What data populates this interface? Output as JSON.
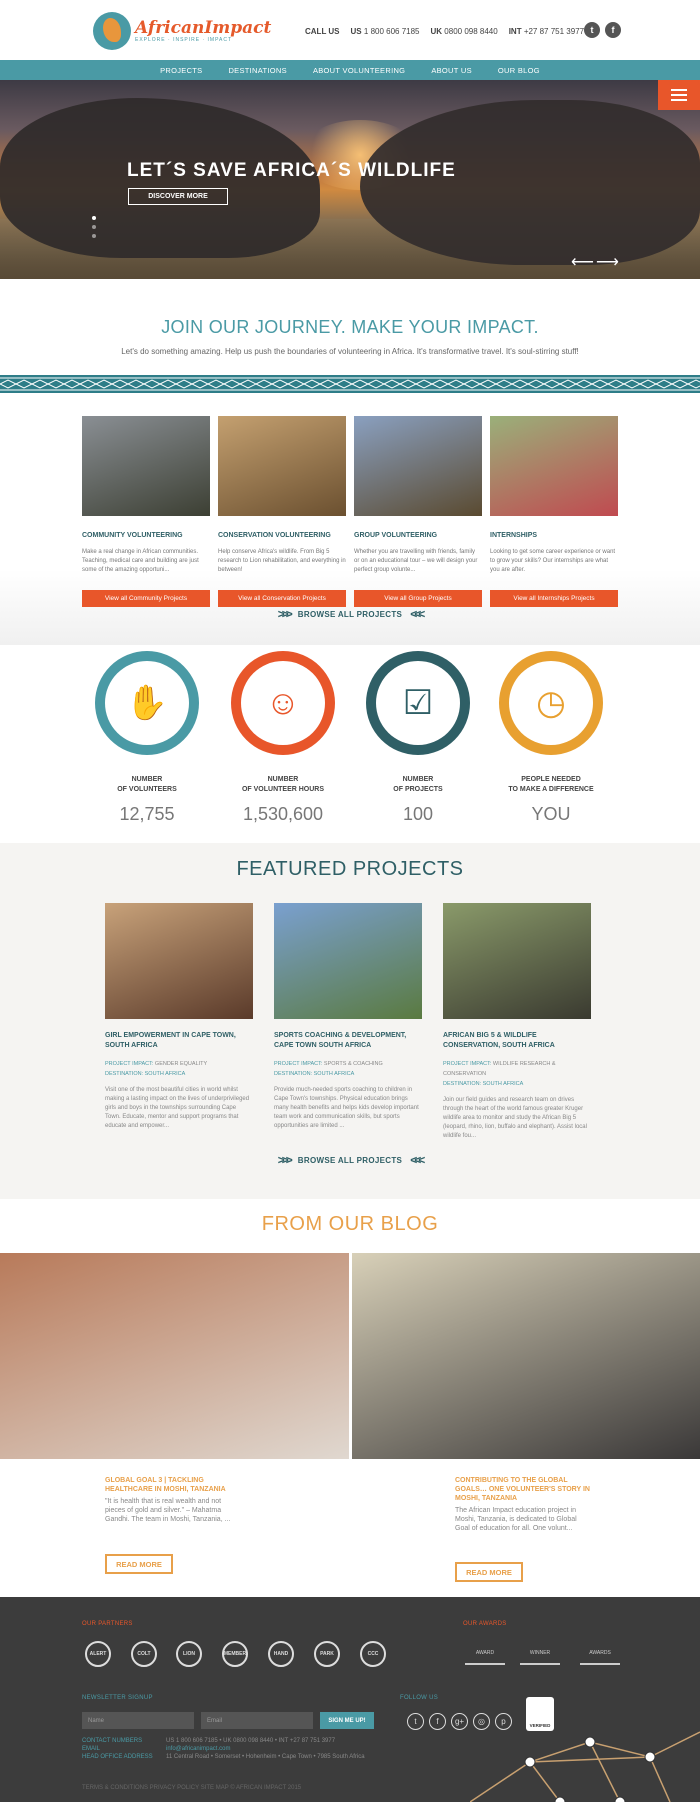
{
  "brand": {
    "name": "AfricanImpact",
    "tagline": "EXPLORE · INSPIRE · IMPACT"
  },
  "contact": {
    "call_label": "CALL US",
    "us_label": "US",
    "us_phone": "1 800 606 7185",
    "uk_label": "UK",
    "uk_phone": "0800 098 8440",
    "int_label": "INT",
    "int_phone": "+27 87 751 3977"
  },
  "social_top": [
    "t",
    "f"
  ],
  "nav": [
    "PROJECTS",
    "DESTINATIONS",
    "ABOUT VOLUNTEERING",
    "ABOUT US",
    "OUR BLOG"
  ],
  "hero": {
    "title": "LET´S SAVE AFRICA´S WILDLIFE",
    "cta": "DISCOVER MORE",
    "arrows": "⟵⟶"
  },
  "intro": {
    "title": "JOIN OUR JOURNEY. MAKE YOUR IMPACT.",
    "text": "Let's do something amazing. Help us push the boundaries of volunteering in Africa. It's transformative travel. It's soul-stirring stuff!"
  },
  "categories": [
    {
      "title": "COMMUNITY VOLUNTEERING",
      "text": "Make a real change in African communities. Teaching, medical care and building are just some of the amazing opportuni...",
      "button": "View all Community Projects",
      "c1": "#8a8f94",
      "c2": "#3c3f33"
    },
    {
      "title": "CONSERVATION VOLUNTEERING",
      "text": "Help conserve Africa's wildlife. From Big 5 research to Lion rehabilitation, and everything in between!",
      "button": "View all Conservation Projects",
      "c1": "#c4a070",
      "c2": "#6b5030"
    },
    {
      "title": "GROUP VOLUNTEERING",
      "text": "Whether you are travelling with friends, family or on an educational tour – we will design your perfect group volunte...",
      "button": "View all Group Projects",
      "c1": "#8aa0c0",
      "c2": "#5a4a30"
    },
    {
      "title": "INTERNSHIPS",
      "text": "Looking to get some career experience or want to grow your skills? Our internships are what you are after.",
      "button": "View all Internships Projects",
      "c1": "#9ab07a",
      "c2": "#c04a50"
    }
  ],
  "browse_label": "BROWSE ALL PROJECTS",
  "stats": [
    {
      "label1": "NUMBER",
      "label2": "OF VOLUNTEERS",
      "value": "12,755",
      "icon": "hand-icon",
      "glyph": "✋",
      "color": "#4a9aa5"
    },
    {
      "label1": "NUMBER",
      "label2": "OF VOLUNTEER HOURS",
      "value": "1,530,600",
      "icon": "person-plus-icon",
      "glyph": "☺",
      "color": "#e8562a"
    },
    {
      "label1": "NUMBER",
      "label2": "OF PROJECTS",
      "value": "100",
      "icon": "clipboard-icon",
      "glyph": "☑",
      "color": "#2f5f66"
    },
    {
      "label1": "PEOPLE NEEDED",
      "label2": "TO MAKE A DIFFERENCE",
      "value": "YOU",
      "icon": "clock-icon",
      "glyph": "◷",
      "color": "#e8a030"
    }
  ],
  "featured": {
    "title": "FEATURED PROJECTS",
    "items": [
      {
        "title": "GIRL EMPOWERMENT IN CAPE TOWN, SOUTH AFRICA",
        "impact_label": "PROJECT IMPACT:",
        "impact": "GENDER EQUALITY",
        "dest_label": "DESTINATION:",
        "dest": "SOUTH AFRICA",
        "text": "Visit one of the most beautiful cities in world whilst making a lasting impact on the lives of underprivileged girls and boys in the townships surrounding Cape Town. Educate, mentor and support programs that educate and empower...",
        "c1": "#c8a27a",
        "c2": "#5a3a2a"
      },
      {
        "title": "SPORTS COACHING & DEVELOPMENT, CAPE TOWN SOUTH AFRICA",
        "impact_label": "PROJECT IMPACT:",
        "impact": "SPORTS & COACHING",
        "dest_label": "DESTINATION:",
        "dest": "SOUTH AFRICA",
        "text": "Provide much-needed sports coaching to children in Cape Town's townships. Physical education brings many health benefits and helps kids develop important team work and communication skills, but sports opportunities are limited ...",
        "c1": "#7aa0d0",
        "c2": "#5a7a40"
      },
      {
        "title": "AFRICAN BIG 5 & WILDLIFE CONSERVATION, SOUTH AFRICA",
        "impact_label": "PROJECT IMPACT:",
        "impact": "WILDLIFE RESEARCH & CONSERVATION",
        "dest_label": "DESTINATION:",
        "dest": "SOUTH AFRICA",
        "text": "Join our field guides and research team on drives through the heart of the world famous greater Kruger wildlife area to monitor and study the African Big 5 (leopard, rhino, lion, buffalo and elephant). Assist local wildlife fou...",
        "c1": "#8a9a6a",
        "c2": "#3a3a30"
      }
    ]
  },
  "blog": {
    "title": "FROM OUR BLOG",
    "posts": [
      {
        "title": "GLOBAL GOAL 3 | TACKLING HEALTHCARE IN MOSHI, TANZANIA",
        "text": "\"It is health that is real wealth and not pieces of gold and silver.\" – Mahatma Gandhi. The team in Moshi, Tanzania, ...",
        "button": "READ MORE",
        "c1": "#b87a5a",
        "c2": "#e0d8d0"
      },
      {
        "title": "CONTRIBUTING TO THE GLOBAL GOALS… ONE VOLUNTEER'S STORY IN MOSHI, TANZANIA",
        "text": "The African Impact education project in Moshi, Tanzania, is dedicated to Global Goal of education for all. One volunt...",
        "button": "READ MORE",
        "c1": "#d8d0b8",
        "c2": "#3a3838"
      }
    ]
  },
  "footer": {
    "partners_label": "OUR PARTNERS",
    "partners": [
      "ALERT",
      "COLT",
      "LION",
      "MEMBER",
      "HAND",
      "PARK",
      "CCC"
    ],
    "awards_label": "OUR AWARDS",
    "awards": [
      "AWARD",
      "WINNER",
      "AWARDS"
    ],
    "newsletter_label": "NEWSLETTER SIGNUP",
    "name_placeholder": "Name",
    "email_placeholder": "Email",
    "signup_label": "SIGN ME UP!",
    "follow_label": "FOLLOW US",
    "follow": [
      "t",
      "f",
      "g+",
      "◎",
      "p"
    ],
    "verified_label": "VERIFIED",
    "contact_numbers_label": "CONTACT NUMBERS",
    "contact_numbers": "US 1 800 606 7185 • UK 0800 098 8440 • INT +27 87 751 3977",
    "email_label": "EMAIL",
    "email": "info@africanimpact.com",
    "office_label": "HEAD OFFICE ADDRESS",
    "office": "11 Central Road • Somerset • Hohenheim • Cape Town • 7985 South Africa",
    "legal": "TERMS & CONDITIONS   PRIVACY POLICY   SITE MAP   © AFRICAN IMPACT 2015"
  }
}
